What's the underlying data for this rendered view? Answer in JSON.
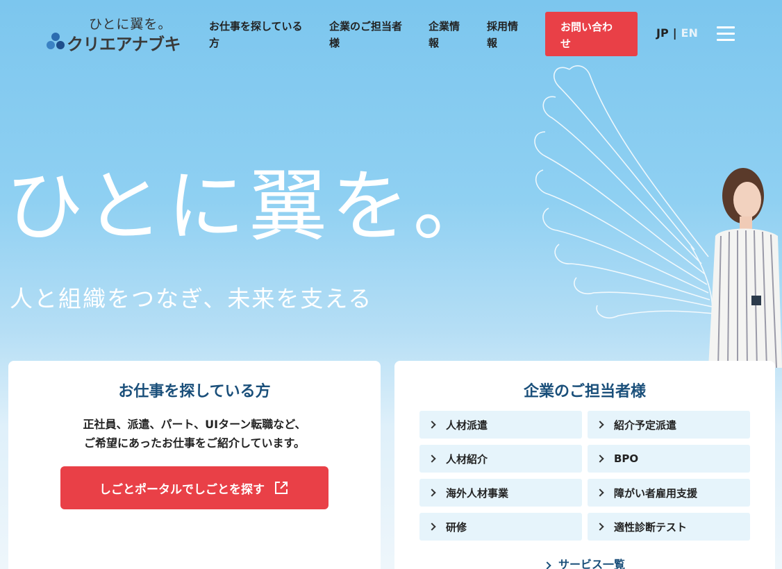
{
  "header": {
    "logo_tagline": "ひとに翼を。",
    "logo_name": "クリエアナブキ",
    "nav": [
      {
        "line1": "お仕事を探している",
        "line2": "方"
      },
      {
        "line1": "企業のご担当者",
        "line2": "様"
      },
      {
        "line1": "企業情",
        "line2": "報"
      },
      {
        "line1": "採用情",
        "line2": "報"
      }
    ],
    "contact": {
      "line1": "お問い合わ",
      "line2": "せ"
    },
    "lang": {
      "jp": "JP",
      "sep": "|",
      "en": "EN"
    }
  },
  "hero": {
    "title": "ひとに翼を。",
    "subtitle": "人と組織をつなぎ、未来を支える"
  },
  "jobseekers": {
    "title": "お仕事を探している方",
    "desc_line1": "正社員、派遣、パート、UIターン転職など、",
    "desc_line2": "ご希望にあったお仕事をご紹介しています。",
    "button": "しごとポータルでしごとを探す"
  },
  "business": {
    "title": "企業のご担当者様",
    "services": [
      "人材派遣",
      "紹介予定派遣",
      "人材紹介",
      "BPO",
      "海外人材事業",
      "障がい者雇用支援",
      "研修",
      "適性診断テスト"
    ],
    "all_link": "サービス一覧"
  },
  "colors": {
    "accent": "#e94047",
    "navy": "#1a4f7a",
    "sky": "#8fd0f2",
    "service_bg": "#e6f4fb"
  }
}
